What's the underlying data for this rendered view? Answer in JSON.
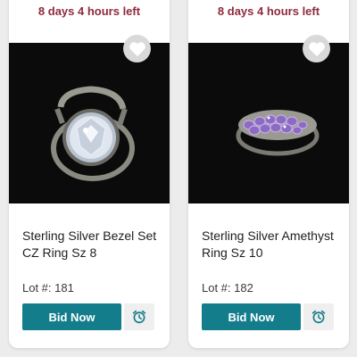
{
  "colors": {
    "accent": "#137d8b",
    "time_left": "#8e2b3d",
    "background": "#ececec"
  },
  "lots": [
    {
      "time_left": "8 days 4 hours left",
      "title": "Sterling Silver Bezel Set CZ Ring Sz 8",
      "lot_number": "Lot #: 181",
      "bid_label": "Bid Now",
      "favorite_icon": "heart-icon",
      "watch_icon": "alarm-clock-icon",
      "image_subject": "silver-bezel-cz-ring"
    },
    {
      "time_left": "8 days 4 hours left",
      "title": "Sterling Silver Amethyst Ring Sz 10",
      "lot_number": "Lot #: 182",
      "bid_label": "Bid Now",
      "favorite_icon": "heart-icon",
      "watch_icon": "alarm-clock-icon",
      "image_subject": "silver-amethyst-ring"
    }
  ]
}
